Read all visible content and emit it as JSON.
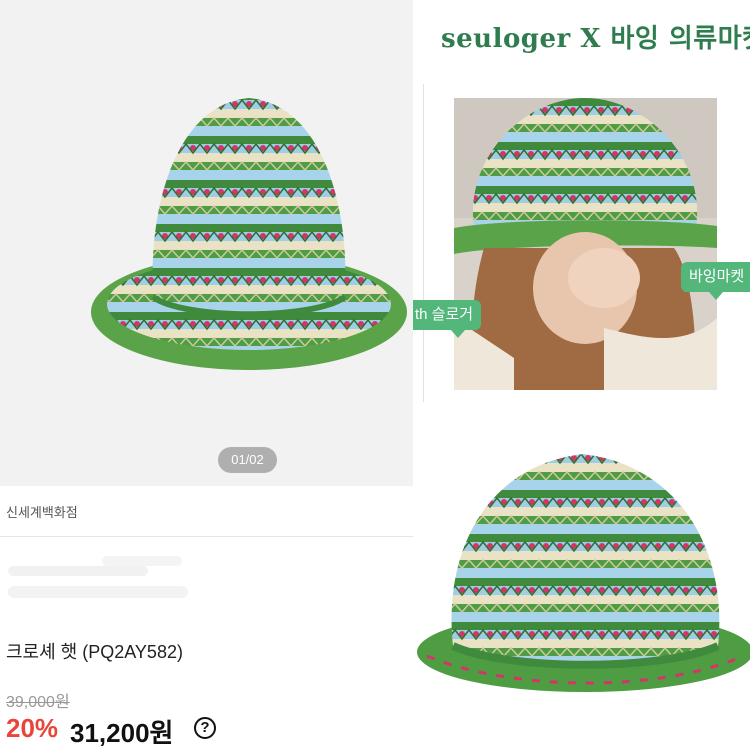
{
  "gallery": {
    "page_indicator": "01/02"
  },
  "product": {
    "store": "신세계백화점",
    "title": "크로셰 햇 (PQ2AY582)",
    "original_price": "39,000원",
    "discount": "20%",
    "sale_price": "31,200원",
    "help_icon": "question-circle-icon"
  },
  "promo": {
    "headline": "seuloger X 바잉 의류마켓",
    "tag_left": "th 슬로거",
    "tag_right": "바잉마켓"
  },
  "colors": {
    "discount": "#e8453c",
    "brand_green": "#2f7d4f",
    "tag_green": "#53b77b"
  }
}
